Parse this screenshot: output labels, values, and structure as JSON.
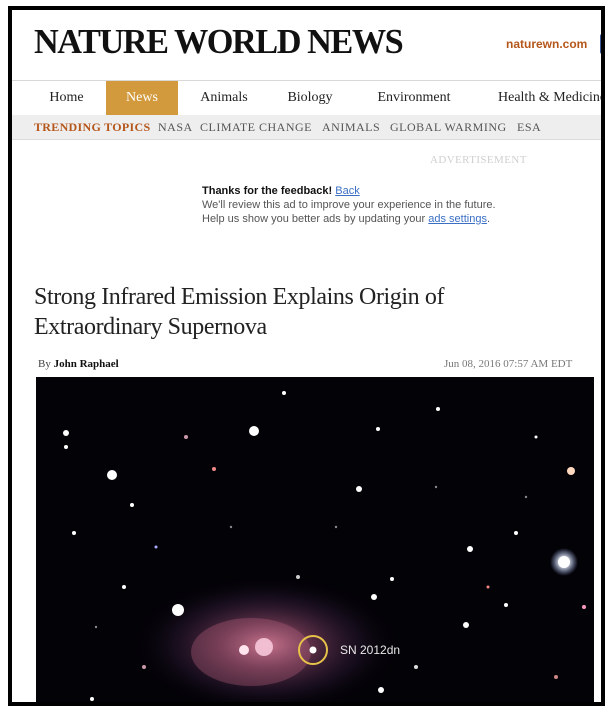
{
  "header": {
    "logo_text": "NATURE WORLD NEWS",
    "site_link": "naturewn.com",
    "social_icon": "facebook-icon"
  },
  "nav": {
    "items": [
      {
        "label": "Home"
      },
      {
        "label": "News",
        "active": true
      },
      {
        "label": "Animals"
      },
      {
        "label": "Biology"
      },
      {
        "label": "Environment"
      },
      {
        "label": "Health & Medicine"
      }
    ]
  },
  "trending": {
    "label": "TRENDING TOPICS",
    "items": [
      "NASA",
      "CLIMATE CHANGE",
      "ANIMALS",
      "GLOBAL WARMING",
      "ESA"
    ]
  },
  "ad": {
    "label": "ADVERTISEMENT",
    "thanks": "Thanks for the feedback!",
    "back_link": "Back",
    "line1": "We'll review this ad to improve your experience in the future.",
    "line2_prefix": "Help us show you better ads by updating your",
    "settings_link": "ads settings",
    "line2_suffix": "."
  },
  "article": {
    "headline": "Strong Infrared Emission Explains Origin of Extraordinary Supernova",
    "by_prefix": "By",
    "author": "John Raphael",
    "date": "Jun 08, 2016 07:57 AM EDT",
    "image_annotation": "SN 2012dn"
  },
  "colors": {
    "accent": "#b5561b",
    "nav_active": "#d29a3d",
    "link": "#3a6fc4"
  }
}
